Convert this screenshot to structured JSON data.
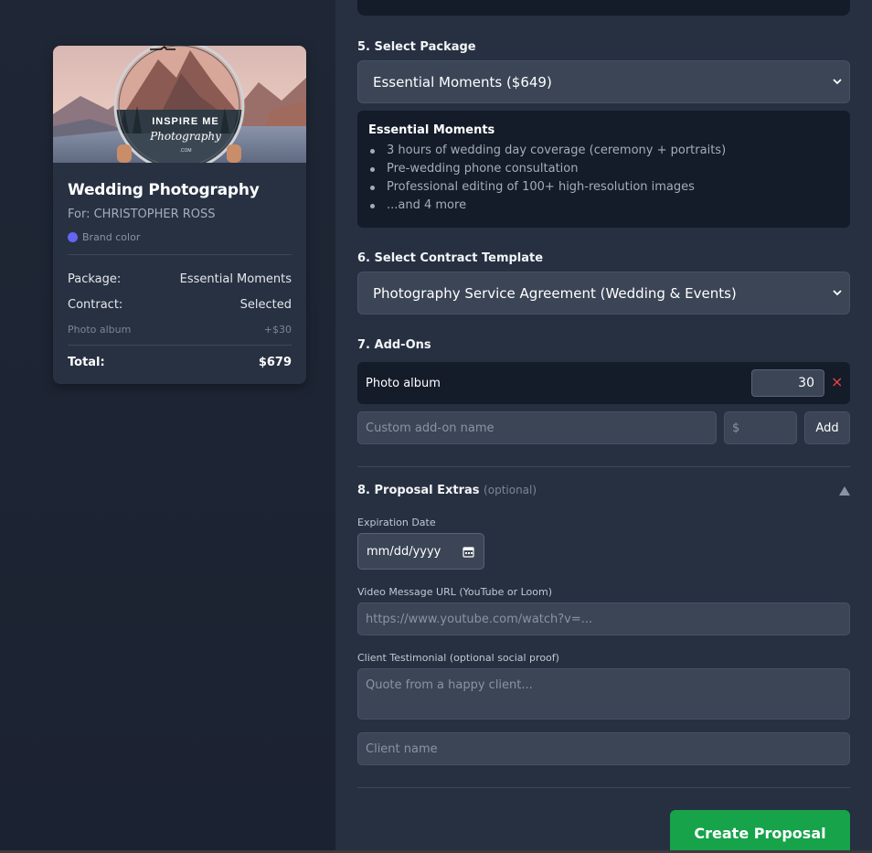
{
  "summary": {
    "logo_line1": "INSPIRE ME",
    "logo_line2": "Photography",
    "logo_line3": ".COM",
    "title": "Wedding Photography",
    "client": "For: CHRISTOPHER ROSS",
    "brand_label": "Brand color",
    "brand_color": "#6366f1",
    "rows": [
      {
        "label": "Package:",
        "value": "Essential Moments"
      },
      {
        "label": "Contract:",
        "value": "Selected"
      }
    ],
    "addon": {
      "label": "Photo album",
      "value": "+$30"
    },
    "total_label": "Total:",
    "total_value": "$679"
  },
  "form": {
    "package": {
      "label": "5. Select Package",
      "selected": "Essential Moments ($649)",
      "detail_title": "Essential Moments",
      "features": [
        "3 hours of wedding day coverage (ceremony + portraits)",
        "Pre-wedding phone consultation",
        "Professional editing of 100+ high-resolution images",
        "...and 4 more"
      ]
    },
    "contract": {
      "label": "6. Select Contract Template",
      "selected": "Photography Service Agreement (Wedding & Events)"
    },
    "addons": {
      "label": "7. Add-Ons",
      "items": [
        {
          "name": "Photo album",
          "price": "30"
        }
      ],
      "remove_icon": "×",
      "name_placeholder": "Custom add-on name",
      "price_placeholder": "$",
      "add_label": "Add"
    },
    "extras": {
      "label": "8. Proposal Extras",
      "optional": "(optional)",
      "expiration_label": "Expiration Date",
      "expiration_placeholder": "mm/dd/yyyy",
      "video_label": "Video Message URL (YouTube or Loom)",
      "video_placeholder": "https://www.youtube.com/watch?v=...",
      "testimonial_label": "Client Testimonial (optional social proof)",
      "testimonial_placeholder": "Quote from a happy client...",
      "client_name_placeholder": "Client name"
    },
    "submit_label": "Create Proposal",
    "accent": "#16a34a"
  }
}
